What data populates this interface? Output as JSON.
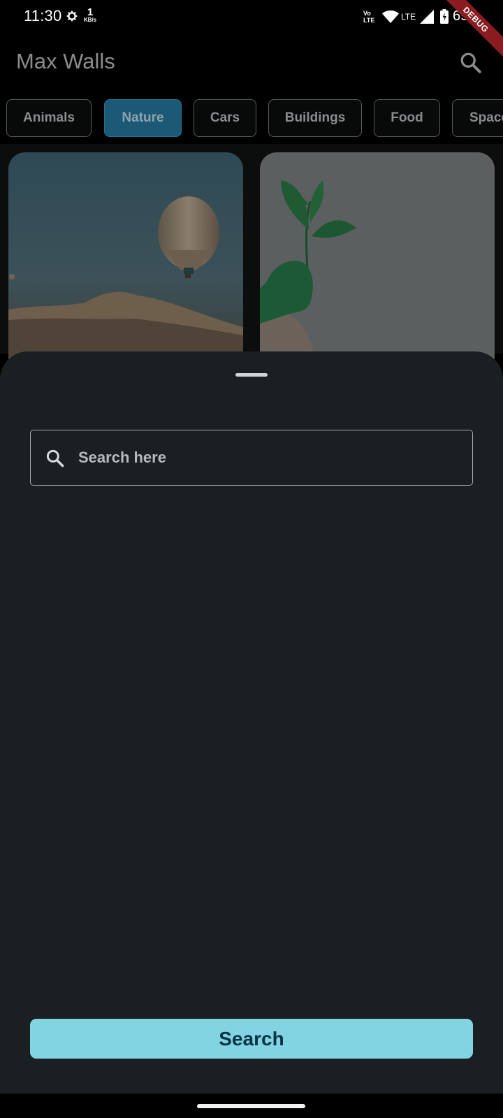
{
  "status_bar": {
    "time": "11:30",
    "net_speed_value": "1",
    "net_speed_unit": "KB/s",
    "volte_line1": "Vo",
    "volte_line2": "LTE",
    "lte_label": "LTE",
    "battery": "69",
    "debug_label": "DEBUG",
    "icons": [
      "gear-icon",
      "wifi-icon",
      "signal-icon",
      "battery-icon"
    ]
  },
  "app_bar": {
    "title": "Max Walls",
    "search_icon": "search-icon"
  },
  "categories": {
    "items": [
      "Animals",
      "Nature",
      "Cars",
      "Buildings",
      "Food",
      "Space"
    ],
    "selected": "Nature"
  },
  "bottom_sheet": {
    "search_placeholder": "Search here",
    "search_value": "",
    "search_button_label": "Search"
  },
  "colors": {
    "accent": "#82d4e2",
    "selected_chip": "#1b5977",
    "sheet_background": "#1a1f22"
  }
}
